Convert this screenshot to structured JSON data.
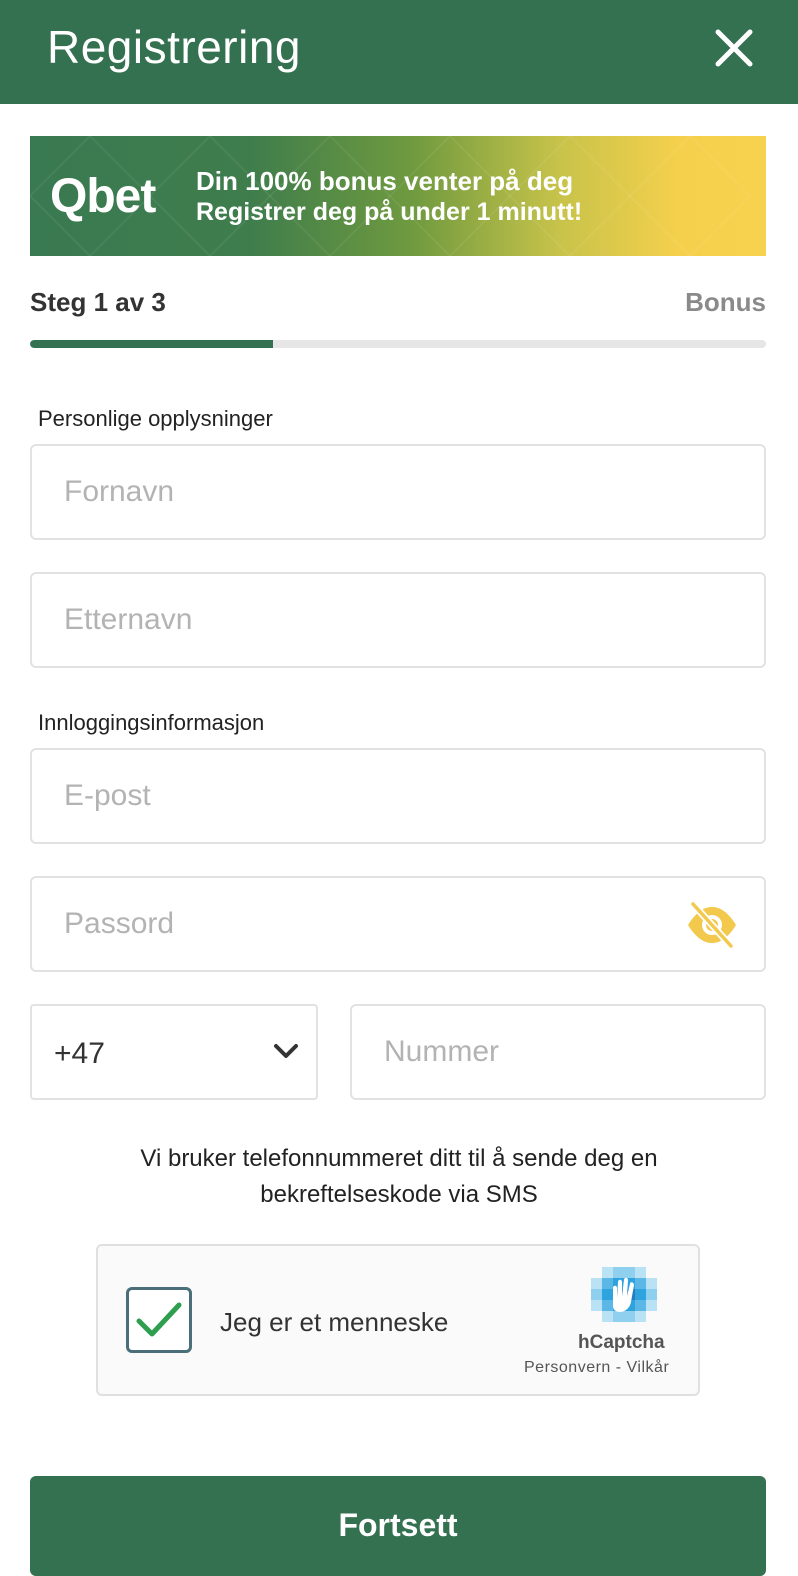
{
  "header": {
    "title": "Registrering",
    "close_icon": "close-icon"
  },
  "banner": {
    "logo": "Qbet",
    "line1": "Din 100% bonus venter på deg",
    "line2": "Registrer deg på under 1 minutt!"
  },
  "steps": {
    "current_label": "Steg 1 av 3",
    "next_label": "Bonus",
    "progress": 0.33
  },
  "personal": {
    "section_label": "Personlige opplysninger",
    "first_name": {
      "placeholder": "Fornavn",
      "value": ""
    },
    "last_name": {
      "placeholder": "Etternavn",
      "value": ""
    }
  },
  "login": {
    "section_label": "Innloggingsinformasjon",
    "email": {
      "placeholder": "E-post",
      "value": ""
    },
    "password": {
      "placeholder": "Passord",
      "value": "",
      "toggle_icon": "eye-off-icon"
    }
  },
  "phone": {
    "country_code": "+47",
    "dropdown_icon": "chevron-down-icon",
    "number": {
      "placeholder": "Nummer",
      "value": ""
    },
    "note": "Vi bruker telefonnummeret ditt til å sende deg en bekreftelseskode via SMS"
  },
  "captcha": {
    "checked": true,
    "label": "Jeg er et menneske",
    "brand": "hCaptcha",
    "privacy_link": "Personvern",
    "separator": " - ",
    "terms_link": "Vilkår"
  },
  "actions": {
    "continue_label": "Fortsett"
  },
  "colors": {
    "primary": "#337150",
    "accent_yellow": "#F2C94C",
    "progress_track": "#E6E6E6"
  }
}
